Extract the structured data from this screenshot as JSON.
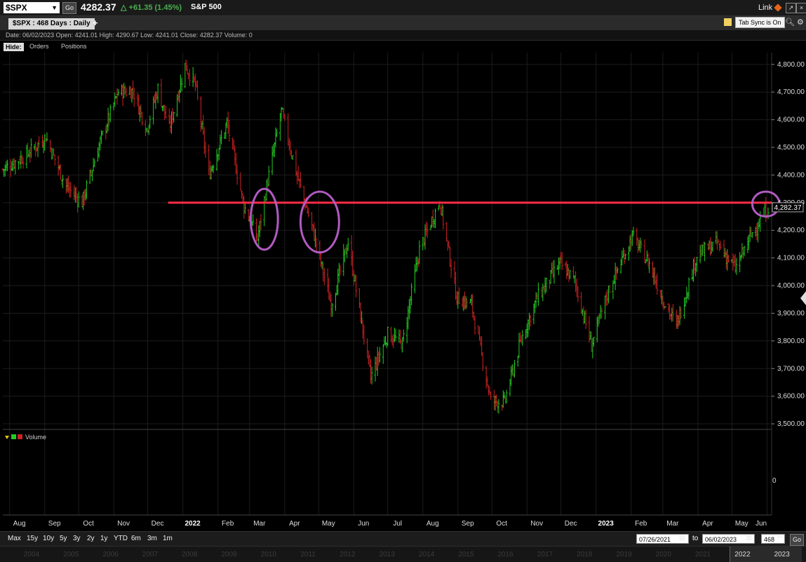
{
  "toolbar": {
    "symbol": "$SPX",
    "go_label": "Go",
    "price": "4282.37",
    "change": "+61.35 (1.45%)",
    "index_name": "S&P 500",
    "link_label": "Link"
  },
  "tabs": {
    "active_tab": "$SPX : 468  Days : Daily",
    "add_tab": "+",
    "tab_sync": "Tab Sync is On"
  },
  "info_line": "Date: 06/02/2023   Open: 4241.01   High: 4290.67   Low: 4241.01   Close: 4282.37   Volume: 0",
  "panel_tabs": {
    "hide": "Hide:",
    "orders": "Orders",
    "positions": "Positions"
  },
  "volume_panel": {
    "label": "Volume",
    "value_label": "0"
  },
  "chart_data": {
    "type": "bar",
    "bar_style": "ohlc",
    "price_tag": "4,282.37",
    "ylim": [
      3490,
      4830
    ],
    "yticks": [
      "4,800.00",
      "4,700.00",
      "4,600.00",
      "4,500.00",
      "4,400.00",
      "4,300.00",
      "4,200.00",
      "4,100.00",
      "4,000.00",
      "3,900.00",
      "3,800.00",
      "3,700.00",
      "3,600.00",
      "3,500.00"
    ],
    "ytick_values": [
      4800,
      4700,
      4600,
      4500,
      4400,
      4300,
      4200,
      4100,
      4000,
      3900,
      3800,
      3700,
      3600,
      3500
    ],
    "x_range": [
      "2021-07-26",
      "2023-06-02"
    ],
    "xticks": [
      {
        "label": "Aug",
        "bold": false
      },
      {
        "label": "Sep",
        "bold": false
      },
      {
        "label": "Oct",
        "bold": false
      },
      {
        "label": "Nov",
        "bold": false
      },
      {
        "label": "Dec",
        "bold": false
      },
      {
        "label": "2022",
        "bold": true
      },
      {
        "label": "Feb",
        "bold": false
      },
      {
        "label": "Mar",
        "bold": false
      },
      {
        "label": "Apr",
        "bold": false
      },
      {
        "label": "May",
        "bold": false
      },
      {
        "label": "Jun",
        "bold": false
      },
      {
        "label": "Jul",
        "bold": false
      },
      {
        "label": "Aug",
        "bold": false
      },
      {
        "label": "Sep",
        "bold": false
      },
      {
        "label": "Oct",
        "bold": false
      },
      {
        "label": "Nov",
        "bold": false
      },
      {
        "label": "Dec",
        "bold": false
      },
      {
        "label": "2023",
        "bold": true
      },
      {
        "label": "Feb",
        "bold": false
      },
      {
        "label": "Mar",
        "bold": false
      },
      {
        "label": "Apr",
        "bold": false
      },
      {
        "label": "May",
        "bold": false
      },
      {
        "label": "Jun",
        "bold": false
      }
    ],
    "tick_dates": [
      "2021-08-01",
      "2021-09-01",
      "2021-10-01",
      "2021-11-01",
      "2021-12-01",
      "2022-01-01",
      "2022-02-01",
      "2022-03-01",
      "2022-04-01",
      "2022-05-01",
      "2022-06-01",
      "2022-07-01",
      "2022-08-01",
      "2022-09-01",
      "2022-10-01",
      "2022-11-01",
      "2022-12-01",
      "2023-01-01",
      "2023-02-01",
      "2023-03-01",
      "2023-04-01",
      "2023-05-01",
      "2023-06-01"
    ],
    "series": [
      {
        "values": [
          {
            "date": "2021-07-26",
            "close": 4420
          },
          {
            "date": "2021-08-15",
            "close": 4470
          },
          {
            "date": "2021-09-02",
            "close": 4537
          },
          {
            "date": "2021-09-20",
            "close": 4358
          },
          {
            "date": "2021-10-04",
            "close": 4300
          },
          {
            "date": "2021-10-20",
            "close": 4520
          },
          {
            "date": "2021-11-05",
            "close": 4700
          },
          {
            "date": "2021-11-18",
            "close": 4704
          },
          {
            "date": "2021-11-30",
            "close": 4567
          },
          {
            "date": "2021-12-10",
            "close": 4712
          },
          {
            "date": "2021-12-20",
            "close": 4568
          },
          {
            "date": "2022-01-03",
            "close": 4797
          },
          {
            "date": "2022-01-12",
            "close": 4726
          },
          {
            "date": "2022-01-24",
            "close": 4400
          },
          {
            "date": "2022-02-09",
            "close": 4587
          },
          {
            "date": "2022-02-24",
            "close": 4288
          },
          {
            "date": "2022-03-08",
            "close": 4170
          },
          {
            "date": "2022-03-16",
            "close": 4357
          },
          {
            "date": "2022-03-29",
            "close": 4632
          },
          {
            "date": "2022-04-12",
            "close": 4397
          },
          {
            "date": "2022-04-27",
            "close": 4183
          },
          {
            "date": "2022-05-12",
            "close": 3930
          },
          {
            "date": "2022-05-27",
            "close": 4158
          },
          {
            "date": "2022-06-16",
            "close": 3667
          },
          {
            "date": "2022-07-01",
            "close": 3825
          },
          {
            "date": "2022-07-14",
            "close": 3790
          },
          {
            "date": "2022-07-29",
            "close": 4130
          },
          {
            "date": "2022-08-16",
            "close": 4305
          },
          {
            "date": "2022-08-31",
            "close": 3955
          },
          {
            "date": "2022-09-13",
            "close": 3932
          },
          {
            "date": "2022-09-30",
            "close": 3585
          },
          {
            "date": "2022-10-12",
            "close": 3577
          },
          {
            "date": "2022-10-27",
            "close": 3807
          },
          {
            "date": "2022-11-10",
            "close": 3956
          },
          {
            "date": "2022-11-30",
            "close": 4080
          },
          {
            "date": "2022-12-13",
            "close": 4019
          },
          {
            "date": "2022-12-28",
            "close": 3783
          },
          {
            "date": "2023-01-12",
            "close": 3983
          },
          {
            "date": "2023-02-02",
            "close": 4179
          },
          {
            "date": "2023-02-17",
            "close": 4079
          },
          {
            "date": "2023-03-01",
            "close": 3951
          },
          {
            "date": "2023-03-13",
            "close": 3855
          },
          {
            "date": "2023-03-31",
            "close": 4109
          },
          {
            "date": "2023-04-18",
            "close": 4154
          },
          {
            "date": "2023-05-04",
            "close": 4061
          },
          {
            "date": "2023-05-19",
            "close": 4191
          },
          {
            "date": "2023-06-02",
            "close": 4282
          }
        ]
      }
    ],
    "annotations": {
      "horizontal_line": {
        "value": 4300,
        "start_date": "2021-12-19",
        "color": "#ff2d46"
      },
      "circles": [
        {
          "date": "2022-03-14",
          "price": 4240,
          "rx_days": 12,
          "ry_price": 110
        },
        {
          "date": "2022-05-02",
          "price": 4230,
          "rx_days": 17,
          "ry_price": 110
        },
        {
          "date": "2023-05-31",
          "price": 4295,
          "rx_days": 12,
          "ry_price": 45
        }
      ],
      "circle_color": "#b05bc0"
    }
  },
  "range_buttons": [
    "Max",
    "15y",
    "10y",
    "5y",
    "3y",
    "2y",
    "1y",
    "YTD",
    "6m",
    "3m",
    "1m"
  ],
  "date_range": {
    "from": "07/26/2021",
    "to_label": "to",
    "to": "06/02/2023",
    "days": "468",
    "go": "Go"
  },
  "navigator_years": [
    "2004",
    "2005",
    "2006",
    "2007",
    "2008",
    "2009",
    "2010",
    "2011",
    "2012",
    "2013",
    "2014",
    "2015",
    "2016",
    "2017",
    "2018",
    "2019",
    "2020",
    "2021",
    "2022",
    "2023"
  ],
  "colors": {
    "up": "#22cc22",
    "down": "#cc2222",
    "background": "#000000",
    "grid": "#1e1e1e"
  }
}
